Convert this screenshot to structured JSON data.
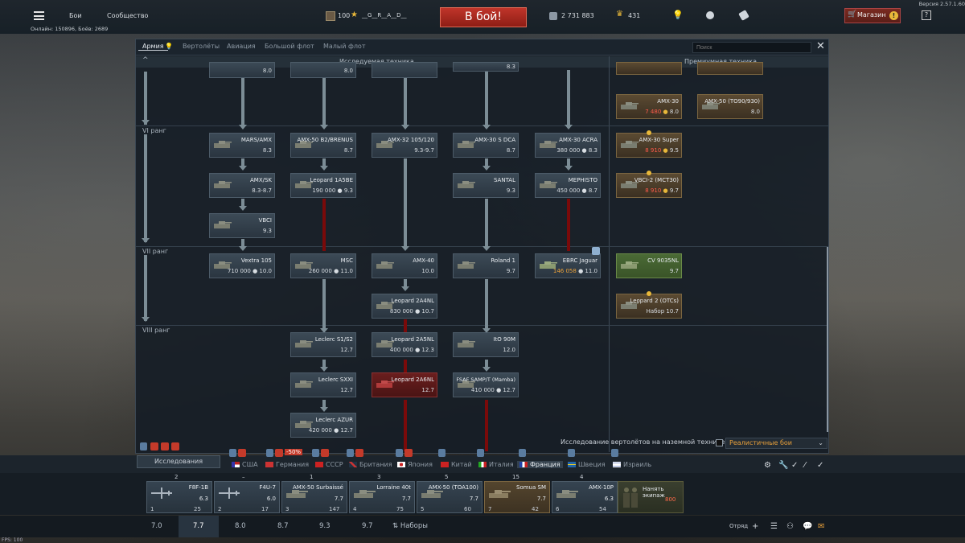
{
  "top": {
    "battles": "Бои",
    "community": "Сообщество",
    "player_level": "100",
    "player_name": "__G__R__A__D__",
    "battle_button": "В бой!",
    "silver_lions": "2 731 883",
    "golden_eagles": "431",
    "shop": "Магазин",
    "shop_alert": "!",
    "help": "?",
    "version": "Версия 2.57.1.60",
    "online": "Онлайн: 150896, Боёв: 2689"
  },
  "tabs": [
    "Армия",
    "Вертолёты",
    "Авиация",
    "Большой флот",
    "Малый флот"
  ],
  "search": {
    "placeholder": "Поиск"
  },
  "close": "✕",
  "headers": {
    "researched": "Исследуемая техника",
    "premium": "Премиумная техника",
    "caret": "^"
  },
  "ranks": {
    "r6": "VI ранг",
    "r7": "VII ранг",
    "r8": "VIII ранг"
  },
  "cards": {
    "top1": {
      "name": "",
      "br": "8.0"
    },
    "top2": {
      "name": "",
      "br": "8.0"
    },
    "top4": {
      "name": "",
      "br": "8.3"
    },
    "amx30": {
      "name": "AMX-30",
      "price": "7 480",
      "br": "8.0"
    },
    "amx50t": {
      "name": "AMX-50 (TO90/930)",
      "br": "8.0"
    },
    "mars": {
      "name": "MARS/AMX",
      "br": "8.3"
    },
    "amx50b2": {
      "name": "AMX-50 B2/BRENUS",
      "br": "8.7"
    },
    "amx32": {
      "name": "AMX-32 105/120",
      "br": "9.3-9.7"
    },
    "amx30sdca": {
      "name": "AMX-30 S DCA",
      "br": "8.7"
    },
    "amx30acra": {
      "name": "AMX-30 ACRA",
      "price": "380 000",
      "br": "8.3"
    },
    "amx30super": {
      "name": "AMX-30 Super",
      "price": "8 910",
      "br": "9.5"
    },
    "amxsk": {
      "name": "AMX/SK",
      "br": "8.3-8.7"
    },
    "leo1a5be": {
      "name": "Leopard 1A5BE",
      "price": "190 000",
      "br": "9.3"
    },
    "santal": {
      "name": "SANTAL",
      "br": "9.3"
    },
    "mephisto": {
      "name": "MEPHISTO",
      "price": "450 000",
      "br": "8.7"
    },
    "vbci2": {
      "name": "VBCI-2 (MCT30)",
      "price": "8 910",
      "br": "9.7"
    },
    "vbci": {
      "name": "VBCI",
      "br": "9.3"
    },
    "vextra": {
      "name": "Vextra 105",
      "price": "710 000",
      "br": "10.0"
    },
    "msc": {
      "name": "MSC",
      "price": "260 000",
      "br": "11.0"
    },
    "amx40": {
      "name": "AMX-40",
      "br": "10.0"
    },
    "roland": {
      "name": "Roland 1",
      "br": "9.7"
    },
    "ebrc": {
      "name": "EBRC Jaguar",
      "price": "146 058",
      "br": "11.0"
    },
    "cv9035": {
      "name": "CV 9035NL",
      "br": "9.7"
    },
    "leo2a4": {
      "name": "Leopard 2A4NL",
      "price": "830 000",
      "br": "10.7"
    },
    "leo2otc": {
      "name": "Leopard 2 (OTCs)",
      "price": "Набор",
      "br": "10.7"
    },
    "leclerc": {
      "name": "Leclerc S1/S2",
      "br": "12.7"
    },
    "leo2a5": {
      "name": "Leopard 2A5NL",
      "price": "400 000",
      "br": "12.3"
    },
    "ito90": {
      "name": "ItO 90M",
      "br": "12.0"
    },
    "leclercsxxi": {
      "name": "Leclerc SXXI",
      "br": "12.7"
    },
    "leo2a6": {
      "name": "Leopard 2A6NL",
      "br": "12.7"
    },
    "samp": {
      "name": "FSAF SAMP/T (Mamba)",
      "price": "410 000",
      "br": "12.7"
    },
    "leclercazur": {
      "name": "Leclerc AZUR",
      "price": "420 000",
      "br": "12.7"
    }
  },
  "heli_research": "Исследование вертолётов на наземной технике",
  "mode": "Реалистичные бои",
  "tray": {
    "research": "Исследования",
    "discount": "-50%",
    "nations": [
      "США",
      "Германия",
      "СССР",
      "Британия",
      "Япония",
      "Китай",
      "Италия",
      "Франция",
      "Швеция",
      "Израиль"
    ]
  },
  "slots": [
    {
      "num": "2",
      "name": "F8F-1B",
      "br": "6.3",
      "crew": "1",
      "sp": "25"
    },
    {
      "num": "–",
      "name": "F4U-7",
      "br": "6.0",
      "crew": "2",
      "sp": "17"
    },
    {
      "num": "1",
      "name": "AMX-50 Surbaissé",
      "br": "7.7",
      "crew": "3",
      "sp": "147"
    },
    {
      "num": "3",
      "name": "Lorraine 40t",
      "br": "7.7",
      "crew": "4",
      "sp": "75"
    },
    {
      "num": "5",
      "name": "AMX-50 (TOA100)",
      "br": "7.7",
      "crew": "5",
      "sp": "60"
    },
    {
      "num": "15",
      "name": "Somua SM",
      "br": "7.7",
      "crew": "7",
      "sp": "42"
    },
    {
      "num": "4",
      "name": "AMX-10P",
      "br": "6.3",
      "crew": "6",
      "sp": "54"
    }
  ],
  "new_crew": {
    "label": "Нанять экипаж",
    "cost": "800"
  },
  "br_bar": [
    "7.0",
    "7.7",
    "8.0",
    "8.7",
    "9.3",
    "9.7"
  ],
  "presets": "Наборы",
  "squad": "Отряд",
  "fps": "FPS: 100",
  "colors": {
    "accent": "#c0352a",
    "gold": "#e8b83a",
    "red_line": "#7a0a0a"
  }
}
